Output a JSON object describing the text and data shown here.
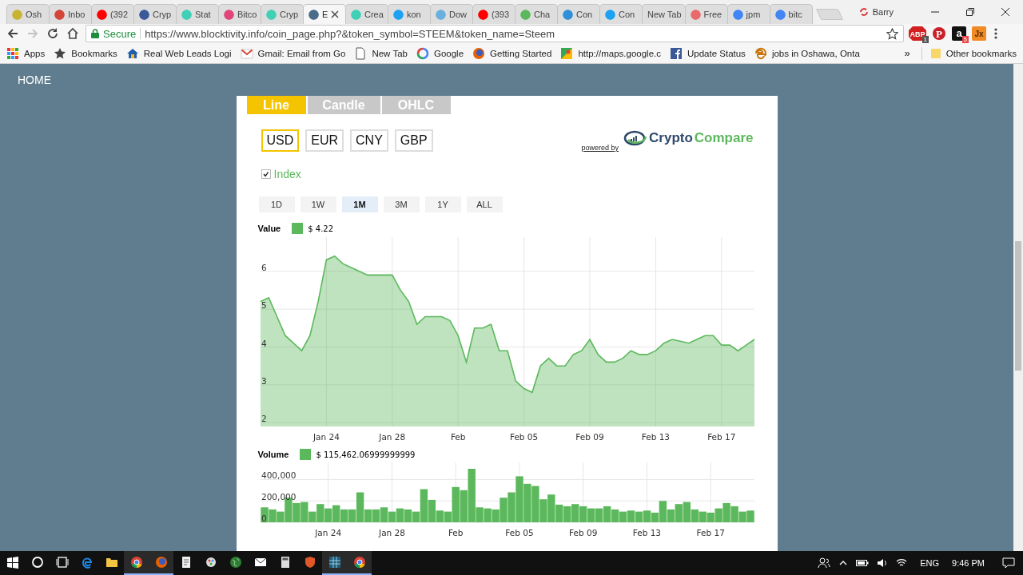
{
  "browser": {
    "tabs": [
      {
        "title": "Osh",
        "color": "#c8b432",
        "selected": false
      },
      {
        "title": "Inbo",
        "color": "#d44638",
        "selected": false
      },
      {
        "title": "(392",
        "color": "#ff0000",
        "selected": false
      },
      {
        "title": "Cryp",
        "color": "#3b5998",
        "selected": false
      },
      {
        "title": "Stat",
        "color": "#3fd0b5",
        "selected": false
      },
      {
        "title": "Bitco",
        "color": "#e0457b",
        "selected": false
      },
      {
        "title": "Cryp",
        "color": "#3fd0b5",
        "selected": false
      },
      {
        "title": "E",
        "color": "#4a6b8a",
        "selected": true
      },
      {
        "title": "Crea",
        "color": "#3fd0b5",
        "selected": false
      },
      {
        "title": "kon",
        "color": "#1da1f2",
        "selected": false
      },
      {
        "title": "Dow",
        "color": "#6ab0de",
        "selected": false
      },
      {
        "title": "(393",
        "color": "#ff0000",
        "selected": false
      },
      {
        "title": "Cha",
        "color": "#5cb85c",
        "selected": false
      },
      {
        "title": "Con",
        "color": "#2f8fd8",
        "selected": false
      },
      {
        "title": "Con",
        "color": "#1da1f2",
        "selected": false
      },
      {
        "title": "New Tab",
        "selected": false
      },
      {
        "title": "Free",
        "color": "#e86a6a",
        "selected": false
      },
      {
        "title": "jpm",
        "color": "#4285f4",
        "selected": false
      },
      {
        "title": "bitc",
        "color": "#4285f4",
        "selected": false
      }
    ],
    "profile": "Barry",
    "nav_buttons": [
      {
        "kind": "back",
        "disabled": false
      },
      {
        "kind": "forward",
        "disabled": true
      },
      {
        "kind": "reload",
        "disabled": false
      },
      {
        "kind": "home",
        "disabled": false
      }
    ],
    "omnibox": {
      "security": "Secure",
      "url": "https://www.blocktivity.info/coin_page.php?&token_symbol=STEEM&token_name=Steem"
    },
    "extensions": [
      {
        "kind": "abp",
        "glyph": "ABP",
        "badge": "1"
      },
      {
        "kind": "pinterest",
        "glyph": "P"
      },
      {
        "kind": "amazon",
        "glyph": "a",
        "badge": "5"
      },
      {
        "kind": "jx",
        "glyph": "Jx"
      }
    ],
    "bookmarks": [
      {
        "kind": "apps",
        "label": "Apps"
      },
      {
        "kind": "star",
        "label": "Bookmarks"
      },
      {
        "kind": "house",
        "label": "Real Web Leads Logi"
      },
      {
        "kind": "gmail",
        "label": "Gmail: Email from Go"
      },
      {
        "kind": "page",
        "label": "New Tab"
      },
      {
        "kind": "google",
        "label": "Google"
      },
      {
        "kind": "firefox",
        "label": "Getting Started"
      },
      {
        "kind": "maps",
        "label": "http://maps.google.c"
      },
      {
        "kind": "facebook",
        "label": "Update Status"
      },
      {
        "kind": "ie",
        "label": "jobs in Oshawa, Onta"
      }
    ],
    "overflow": "»",
    "other_bookmarks": "Other bookmarks"
  },
  "page": {
    "nav": "HOME",
    "chart_types": [
      {
        "label": "Line",
        "selected": true
      },
      {
        "label": "Candle",
        "selected": false
      },
      {
        "label": "OHLC",
        "selected": false
      }
    ],
    "currencies": [
      {
        "label": "USD",
        "selected": true
      },
      {
        "label": "EUR",
        "selected": false
      },
      {
        "label": "CNY",
        "selected": false
      },
      {
        "label": "GBP",
        "selected": false
      }
    ],
    "powered_by": "powered by",
    "logo": [
      "Crypto",
      "Compare"
    ],
    "index": {
      "label": "Index",
      "checked": true
    },
    "ranges": [
      {
        "label": "1D",
        "selected": false
      },
      {
        "label": "1W",
        "selected": false
      },
      {
        "label": "1M",
        "selected": true
      },
      {
        "label": "3M",
        "selected": false
      },
      {
        "label": "1Y",
        "selected": false
      },
      {
        "label": "ALL",
        "selected": false
      }
    ],
    "value_chart": {
      "reading": "$ 4.22",
      "chart_data": {
        "type": "area",
        "grid": true,
        "ylim": [
          1.9,
          6.9
        ],
        "yticks": [
          2,
          3,
          4,
          5,
          6
        ],
        "categories": [
          null,
          null,
          null,
          null,
          null,
          null,
          null,
          null,
          "Jan 24",
          null,
          null,
          null,
          null,
          null,
          null,
          null,
          "Jan 28",
          null,
          null,
          null,
          null,
          null,
          null,
          null,
          "Feb",
          null,
          null,
          null,
          null,
          null,
          null,
          null,
          "Feb 05",
          null,
          null,
          null,
          null,
          null,
          null,
          null,
          "Feb 09",
          null,
          null,
          null,
          null,
          null,
          null,
          null,
          "Feb 13",
          null,
          null,
          null,
          null,
          null,
          null,
          null,
          "Feb 17",
          null,
          null,
          null,
          null
        ],
        "series": [
          {
            "name": "Value",
            "color": "#5cb85c",
            "values": [
              5.2,
              5.3,
              4.8,
              4.3,
              4.1,
              3.9,
              4.3,
              5.2,
              6.3,
              6.4,
              6.2,
              6.1,
              6.0,
              5.9,
              5.9,
              5.9,
              5.9,
              5.5,
              5.2,
              4.6,
              4.8,
              4.8,
              4.8,
              4.7,
              4.3,
              3.6,
              4.5,
              4.5,
              4.6,
              3.9,
              3.9,
              3.1,
              2.9,
              2.8,
              3.5,
              3.7,
              3.5,
              3.5,
              3.8,
              3.9,
              4.2,
              3.8,
              3.6,
              3.6,
              3.7,
              3.9,
              3.8,
              3.8,
              3.9,
              4.1,
              4.2,
              4.15,
              4.1,
              4.2,
              4.3,
              4.3,
              4.05,
              4.05,
              3.9,
              4.05,
              4.2
            ]
          }
        ]
      }
    },
    "volume_chart": {
      "reading": "$ 115,462.06999999999",
      "chart_data": {
        "type": "bar",
        "grid": true,
        "ylim": [
          0,
          560000
        ],
        "categories": [
          null,
          null,
          null,
          null,
          null,
          null,
          null,
          null,
          "Jan 24",
          null,
          null,
          null,
          null,
          null,
          null,
          null,
          "Jan 28",
          null,
          null,
          null,
          null,
          null,
          null,
          null,
          "Feb",
          null,
          null,
          null,
          null,
          null,
          null,
          null,
          "Feb 05",
          null,
          null,
          null,
          null,
          null,
          null,
          null,
          "Feb 09",
          null,
          null,
          null,
          null,
          null,
          null,
          null,
          "Feb 13",
          null,
          null,
          null,
          null,
          null,
          null,
          null,
          "Feb 17",
          null,
          null,
          null,
          null,
          null
        ],
        "yticks": [
          {
            "value": 0,
            "label": "0"
          },
          {
            "value": 200000,
            "label": "200,000"
          },
          {
            "value": 400000,
            "label": "400,000"
          }
        ],
        "series": [
          {
            "name": "Volume",
            "color": "#5cb85c",
            "values": [
              140000,
              120000,
              100000,
              230000,
              180000,
              190000,
              100000,
              170000,
              130000,
              160000,
              120000,
              120000,
              280000,
              120000,
              120000,
              140000,
              100000,
              130000,
              120000,
              100000,
              310000,
              210000,
              110000,
              100000,
              330000,
              300000,
              500000,
              140000,
              130000,
              120000,
              230000,
              280000,
              430000,
              360000,
              340000,
              215000,
              260000,
              165000,
              150000,
              170000,
              150000,
              130000,
              130000,
              150000,
              120000,
              100000,
              110000,
              100000,
              110000,
              90000,
              200000,
              120000,
              170000,
              190000,
              120000,
              100000,
              90000,
              130000,
              180000,
              150000,
              100000,
              110000
            ]
          }
        ]
      }
    }
  },
  "taskbar": {
    "apps": [
      {
        "kind": "start",
        "running": false
      },
      {
        "kind": "search",
        "running": false
      },
      {
        "kind": "taskview",
        "running": false
      },
      {
        "kind": "edge",
        "running": false
      },
      {
        "kind": "folder",
        "running": false
      },
      {
        "kind": "chrome",
        "running": true
      },
      {
        "kind": "firefox",
        "running": true
      },
      {
        "kind": "document",
        "running": false
      },
      {
        "kind": "paint",
        "running": false
      },
      {
        "kind": "globe",
        "running": false
      },
      {
        "kind": "mail",
        "running": false
      },
      {
        "kind": "calculator",
        "running": false
      },
      {
        "kind": "shield",
        "running": false
      },
      {
        "kind": "spreadsheet",
        "running": true
      },
      {
        "kind": "chrome",
        "running": true
      }
    ],
    "language": "ENG",
    "time": "9:46 PM"
  }
}
